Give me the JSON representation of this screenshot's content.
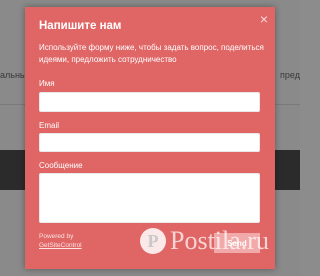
{
  "background": {
    "left_text": "альны",
    "right_text": "пред"
  },
  "modal": {
    "title": "Напишите нам",
    "close_glyph": "×",
    "description": "Используйте форму ниже, чтобы задать вопрос, поделиться идеями, предложить сотрудничество",
    "fields": {
      "name_label": "Имя",
      "email_label": "Email",
      "message_label": "Сообщение"
    },
    "powered_by": "Powered by",
    "powered_link": "GetSiteControl",
    "send_label": "Send"
  },
  "watermark": {
    "text": "Postila.ru",
    "logo_letter": "P"
  },
  "colors": {
    "modal_bg": "#e06666",
    "button_bg": "#f1a9a9",
    "overlay": "#8a8a8a"
  },
  "icons": [
    "close-icon"
  ]
}
